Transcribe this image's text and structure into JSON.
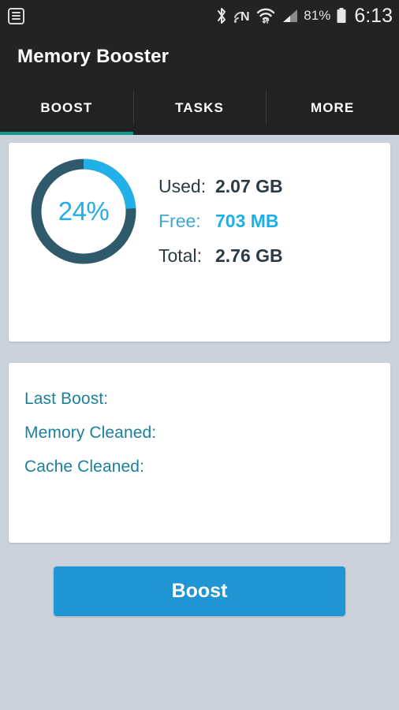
{
  "status_bar": {
    "notification_icon": "list-notification-icon",
    "bluetooth_icon": "bluetooth-icon",
    "nfc_icon": "nfc-icon",
    "wifi_icon": "wifi-icon",
    "signal_icon": "cellular-signal-icon",
    "battery_percent": "81%",
    "battery_icon": "battery-icon",
    "time": "6:13",
    "background_color": "#232323"
  },
  "app_bar": {
    "title": "Memory Booster",
    "background_color": "#232323"
  },
  "tabs": {
    "active_index": 0,
    "indicator_color": "#11968c",
    "items": [
      {
        "label": "BOOST"
      },
      {
        "label": "TASKS"
      },
      {
        "label": "MORE"
      }
    ]
  },
  "memory_card": {
    "percent_label": "24%",
    "percent_value": 24,
    "ring_progress_color": "#22b0e8",
    "ring_track_color": "#2e5a6b",
    "rows": [
      {
        "key": "Used:",
        "value": "2.07 GB",
        "highlight": false
      },
      {
        "key": "Free:",
        "value": "703 MB",
        "highlight": true
      },
      {
        "key": "Total:",
        "value": "2.76 GB",
        "highlight": false
      }
    ]
  },
  "stats_card": {
    "lines": [
      {
        "label": "Last Boost:",
        "value": ""
      },
      {
        "label": "Memory Cleaned:",
        "value": ""
      },
      {
        "label": "Cache Cleaned:",
        "value": ""
      }
    ],
    "text_color": "#1b7f9e"
  },
  "boost_button": {
    "label": "Boost",
    "color": "#1f95d4"
  },
  "page": {
    "background_color": "#cbd2db"
  }
}
